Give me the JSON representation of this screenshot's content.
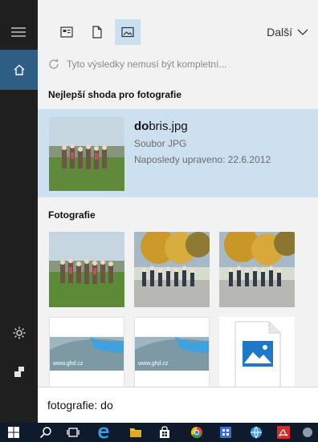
{
  "window": {
    "tabs": [
      {
        "name": "apps-tab-icon"
      },
      {
        "name": "documents-tab-icon"
      },
      {
        "name": "photos-tab-icon",
        "active": true
      }
    ],
    "more_label": "Další"
  },
  "notice": "Tyto výsledky nemusí být kompletní...",
  "best_match": {
    "heading": "Nejlepší shoda pro fotografie",
    "name_bold": "do",
    "name_rest": "bris.jpg",
    "type": "Soubor JPG",
    "modified": "Naposledy upraveno: 22.6.2012"
  },
  "photos": {
    "heading": "Fotografie",
    "items": [
      {
        "kind": "group-photo"
      },
      {
        "kind": "autumn-group-photo"
      },
      {
        "kind": "autumn-group-photo"
      },
      {
        "kind": "website-screenshot",
        "caption": "www.ghd.cz"
      },
      {
        "kind": "website-screenshot",
        "caption": "www.ghd.cz"
      },
      {
        "kind": "image-file-icon"
      }
    ]
  },
  "search": {
    "value": "fotografie: do"
  },
  "colors": {
    "accent": "#2e5d86",
    "selection": "#cde0f0",
    "rail": "#1f1f1f",
    "taskbar": "#0f1a2c"
  }
}
